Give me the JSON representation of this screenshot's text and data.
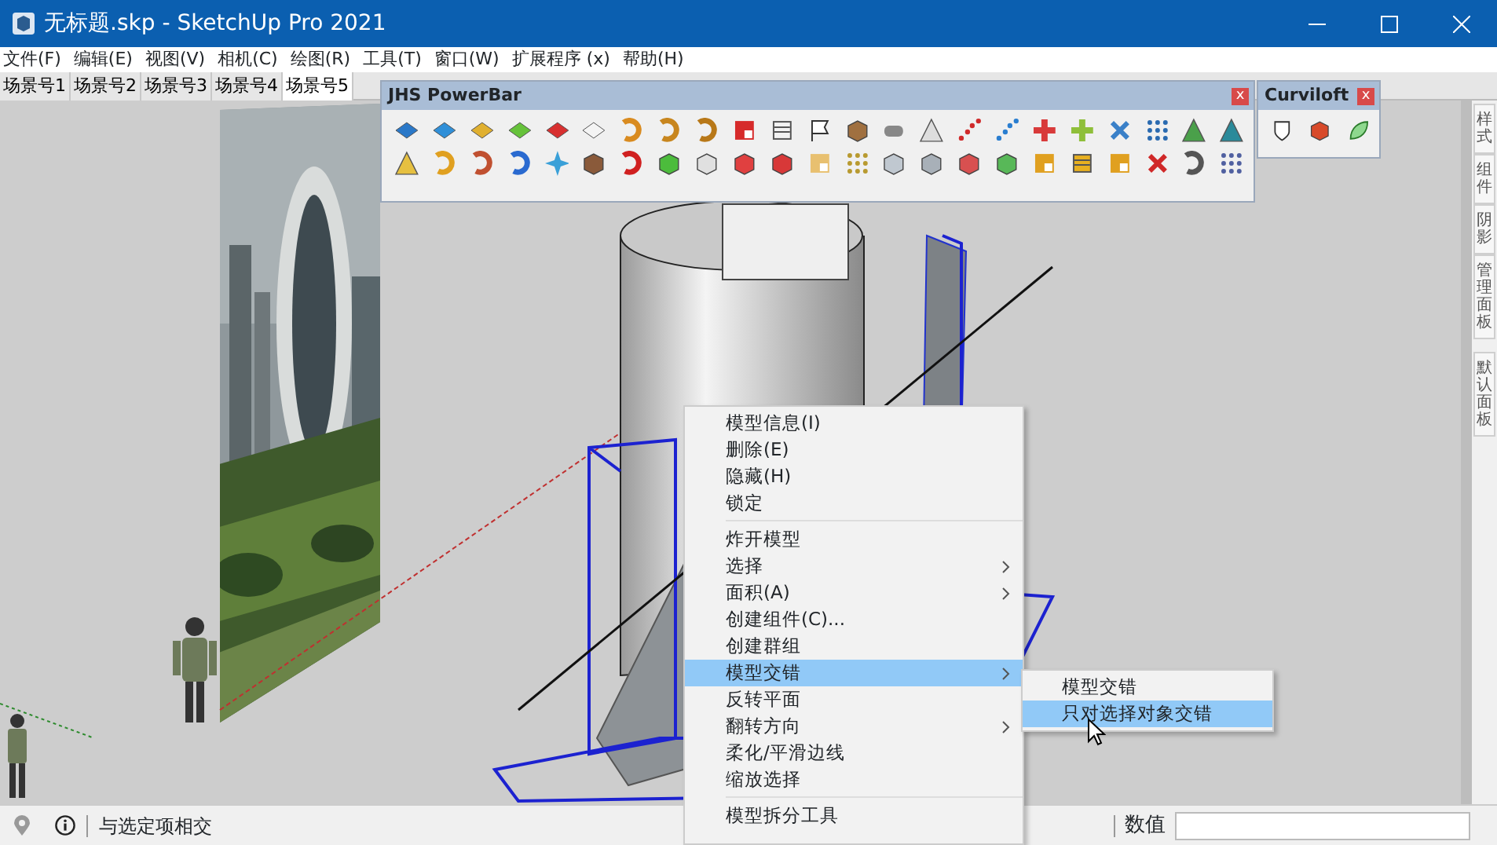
{
  "window": {
    "title": "无标题.skp - SketchUp Pro 2021"
  },
  "menu_bar": [
    "文件(F)",
    "编辑(E)",
    "视图(V)",
    "相机(C)",
    "绘图(R)",
    "工具(T)",
    "窗口(W)",
    "扩展程序 (x)",
    "帮助(H)"
  ],
  "scene_tabs": [
    {
      "label": "场景号1",
      "selected": false
    },
    {
      "label": "场景号2",
      "selected": false
    },
    {
      "label": "场景号3",
      "selected": false
    },
    {
      "label": "场景号4",
      "selected": false
    },
    {
      "label": "场景号5",
      "selected": true
    }
  ],
  "toolbars": [
    {
      "title": "JHS PowerBar",
      "close_label": "x"
    },
    {
      "title": "Curviloft",
      "close_label": "x"
    }
  ],
  "tray_tabs": [
    "样式",
    "组件",
    "阴影",
    "管理面板",
    "默认面板"
  ],
  "context_menu": {
    "items": [
      {
        "kind": "item",
        "label": "模型信息(I)",
        "submenu": false,
        "selected": false
      },
      {
        "kind": "item",
        "label": "删除(E)",
        "submenu": false,
        "selected": false
      },
      {
        "kind": "item",
        "label": "隐藏(H)",
        "submenu": false,
        "selected": false
      },
      {
        "kind": "item",
        "label": "锁定",
        "submenu": false,
        "selected": false
      },
      {
        "kind": "separator"
      },
      {
        "kind": "item",
        "label": "炸开模型",
        "submenu": false,
        "selected": false
      },
      {
        "kind": "item",
        "label": "选择",
        "submenu": true,
        "selected": false
      },
      {
        "kind": "item",
        "label": "面积(A)",
        "submenu": true,
        "selected": false
      },
      {
        "kind": "item",
        "label": "创建组件(C)...",
        "submenu": false,
        "selected": false
      },
      {
        "kind": "item",
        "label": "创建群组",
        "submenu": false,
        "selected": false
      },
      {
        "kind": "item",
        "label": "模型交错",
        "submenu": true,
        "selected": true
      },
      {
        "kind": "item",
        "label": "反转平面",
        "submenu": false,
        "selected": false
      },
      {
        "kind": "item",
        "label": "翻转方向",
        "submenu": true,
        "selected": false
      },
      {
        "kind": "item",
        "label": "柔化/平滑边线",
        "submenu": false,
        "selected": false
      },
      {
        "kind": "item",
        "label": "缩放选择",
        "submenu": false,
        "selected": false
      },
      {
        "kind": "separator"
      },
      {
        "kind": "item",
        "label": "模型拆分工具",
        "submenu": false,
        "selected": false
      }
    ]
  },
  "submenu": {
    "items": [
      {
        "label": "模型交错",
        "selected": false
      },
      {
        "label": "只对选择对象交错",
        "selected": true
      }
    ]
  },
  "status_bar": {
    "hint": "与选定项相交",
    "measurements_label": "数值"
  }
}
